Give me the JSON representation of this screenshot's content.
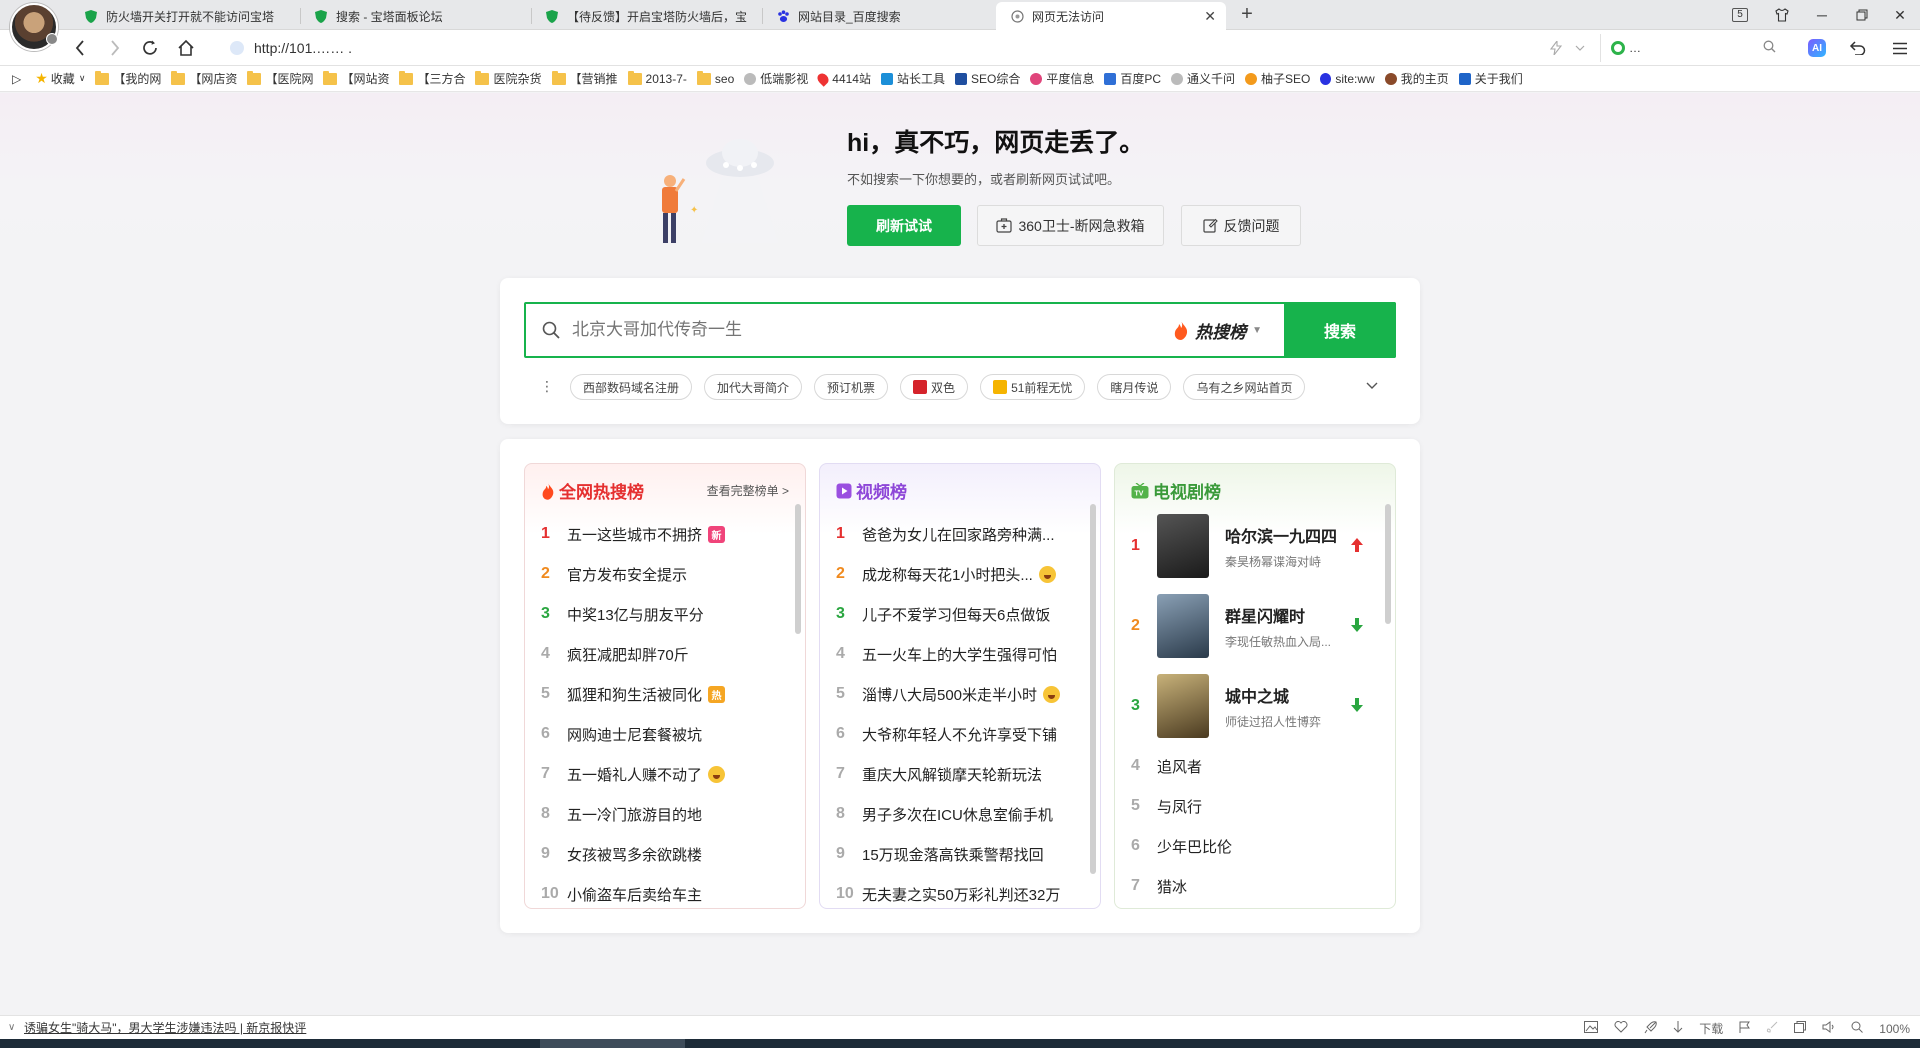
{
  "browser": {
    "tabs": [
      {
        "title": "防火墙开关打开就不能访问宝塔",
        "icon": "shield-icon"
      },
      {
        "title": "搜索 - 宝塔面板论坛",
        "icon": "shield-icon"
      },
      {
        "title": "【待反馈】开启宝塔防火墙后，宝",
        "icon": "shield-icon"
      },
      {
        "title": "网站目录_百度搜索",
        "icon": "baidu-paw-icon"
      },
      {
        "title": "网页无法访问",
        "icon": "globe-icon",
        "active": true
      }
    ],
    "tab_count": "5",
    "url": "http://101.…… .",
    "search_engine_text": "…",
    "bookmarks": [
      {
        "label": "收藏",
        "icon": "star-icon"
      },
      {
        "label": "【我的网",
        "icon": "folder-icon"
      },
      {
        "label": "【网店资",
        "icon": "folder-icon"
      },
      {
        "label": "【医院网",
        "icon": "folder-icon"
      },
      {
        "label": "【网站资",
        "icon": "folder-icon"
      },
      {
        "label": "【三方合",
        "icon": "folder-icon"
      },
      {
        "label": "医院杂货",
        "icon": "folder-icon"
      },
      {
        "label": "【营销推",
        "icon": "folder-icon"
      },
      {
        "label": "2013-7-",
        "icon": "folder-icon"
      },
      {
        "label": "seo",
        "icon": "folder-icon"
      },
      {
        "label": "低端影视",
        "icon": "globe-icon"
      },
      {
        "label": "4414站",
        "icon": "pin-icon"
      },
      {
        "label": "站长工具",
        "icon": "tool-icon"
      },
      {
        "label": "SEO综合",
        "icon": "seo-icon"
      },
      {
        "label": "平度信息",
        "icon": "flower-icon"
      },
      {
        "label": "百度PC",
        "icon": "chart-icon"
      },
      {
        "label": "通义千问",
        "icon": "globe-icon"
      },
      {
        "label": "柚子SEO",
        "icon": "fruit-icon"
      },
      {
        "label": "site:ww",
        "icon": "baidu-paw-icon"
      },
      {
        "label": "我的主页",
        "icon": "avatar-icon"
      },
      {
        "label": "关于我们",
        "icon": "dd-icon"
      }
    ]
  },
  "error_page": {
    "title": "hi，真不巧，网页走丢了。",
    "subtitle": "不如搜索一下你想要的，或者刷新网页试试吧。",
    "refresh_label": "刷新试试",
    "rescue_label": "360卫士-断网急救箱",
    "feedback_label": "反馈问题"
  },
  "search": {
    "placeholder": "北京大哥加代传奇一生",
    "hot_label": "热搜榜",
    "button_label": "搜索",
    "chips": [
      "西部数码域名注册",
      "加代大哥简介",
      "预订机票",
      "双色",
      "51前程无忧",
      "瞎月传说",
      "乌有之乡网站首页"
    ]
  },
  "hot_panel": {
    "title": "全网热搜榜",
    "full_list_label": "查看完整榜单 >",
    "items": [
      {
        "rank": "1",
        "text": "五一这些城市不拥挤",
        "badge": "新"
      },
      {
        "rank": "2",
        "text": "官方发布安全提示"
      },
      {
        "rank": "3",
        "text": "中奖13亿与朋友平分"
      },
      {
        "rank": "4",
        "text": "疯狂减肥却胖70斤"
      },
      {
        "rank": "5",
        "text": "狐狸和狗生活被同化",
        "badge": "热"
      },
      {
        "rank": "6",
        "text": "网购迪士尼套餐被坑"
      },
      {
        "rank": "7",
        "text": "五一婚礼人赚不动了",
        "emoji": true
      },
      {
        "rank": "8",
        "text": "五一冷门旅游目的地"
      },
      {
        "rank": "9",
        "text": "女孩被骂多余欲跳楼"
      },
      {
        "rank": "10",
        "text": "小偷盗车后卖给车主"
      }
    ]
  },
  "video_panel": {
    "title": "视频榜",
    "items": [
      {
        "rank": "1",
        "text": "爸爸为女儿在回家路旁种满..."
      },
      {
        "rank": "2",
        "text": "成龙称每天花1小时把头...",
        "emoji": true
      },
      {
        "rank": "3",
        "text": "儿子不爱学习但每天6点做饭"
      },
      {
        "rank": "4",
        "text": "五一火车上的大学生强得可怕"
      },
      {
        "rank": "5",
        "text": "淄博八大局500米走半小时",
        "emoji": true
      },
      {
        "rank": "6",
        "text": "大爷称年轻人不允许享受下铺"
      },
      {
        "rank": "7",
        "text": "重庆大风解锁摩天轮新玩法"
      },
      {
        "rank": "8",
        "text": "男子多次在ICU休息室偷手机"
      },
      {
        "rank": "9",
        "text": "15万现金落高铁乘警帮找回"
      },
      {
        "rank": "10",
        "text": "无夫妻之实50万彩礼判还32万"
      }
    ]
  },
  "tv_panel": {
    "title": "电视剧榜",
    "top": [
      {
        "rank": "1",
        "name": "哈尔滨一九四四",
        "desc": "秦昊杨幂谍海对峙",
        "trend": "up",
        "poster_color": "#2b2b2b"
      },
      {
        "rank": "2",
        "name": "群星闪耀时",
        "desc": "李现任敏热血入局...",
        "trend": "down",
        "poster_color": "#3b4a5a"
      },
      {
        "rank": "3",
        "name": "城中之城",
        "desc": "师徒过招人性博弈",
        "trend": "down",
        "poster_color": "#6a5a3a"
      }
    ],
    "items": [
      {
        "rank": "4",
        "text": "追风者"
      },
      {
        "rank": "5",
        "text": "与凤行"
      },
      {
        "rank": "6",
        "text": "少年巴比伦"
      },
      {
        "rank": "7",
        "text": "猎冰"
      }
    ]
  },
  "statusbar": {
    "news": "诱骗女生\"骑大马\"，男大学生涉嫌违法吗 | 新京报快评",
    "download_label": "下载",
    "zoom": "100%"
  }
}
